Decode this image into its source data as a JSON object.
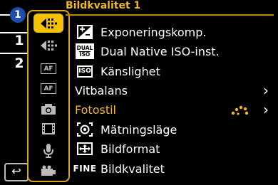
{
  "header": {
    "title": "Bildkvalitet 1"
  },
  "pages": {
    "current": "1",
    "page1": "1",
    "page2": "2"
  },
  "categories": [
    {
      "icon": "photo-quality-icon"
    },
    {
      "icon": "photo-quality-2-icon"
    },
    {
      "icon": "af-icon"
    },
    {
      "icon": "af-custom-icon"
    },
    {
      "icon": "camera-icon"
    },
    {
      "icon": "film-icon"
    },
    {
      "icon": "microphone-icon"
    },
    {
      "icon": "video-camera-icon"
    }
  ],
  "menu": {
    "items": [
      {
        "label": "Exponeringskomp.",
        "icon": "exposure-comp-icon"
      },
      {
        "label": "Dual Native ISO-inst.",
        "icon": "dual-iso-icon",
        "icon_text_top": "DUAL",
        "icon_text_bottom": "ISO"
      },
      {
        "label": "Känslighet",
        "icon": "iso-icon",
        "icon_text": "ISO"
      },
      {
        "label": "Vitbalans",
        "chevron": "›"
      },
      {
        "label": "Fotostil",
        "chevron": "›",
        "value_icon": "photo-style-icon"
      },
      {
        "label": "Mätningsläge",
        "icon": "metering-icon"
      },
      {
        "label": "Bildformat",
        "icon": "aspect-ratio-icon"
      },
      {
        "label": "Bildkvalitet",
        "icon": "fine-quality-icon",
        "icon_text": "FINE"
      }
    ]
  },
  "back": {
    "icon": "return-icon",
    "glyph": "↩"
  },
  "colors": {
    "accent": "#f5c200",
    "highlight_text": "#f3b81c",
    "page_badge": "#1e4db0"
  }
}
